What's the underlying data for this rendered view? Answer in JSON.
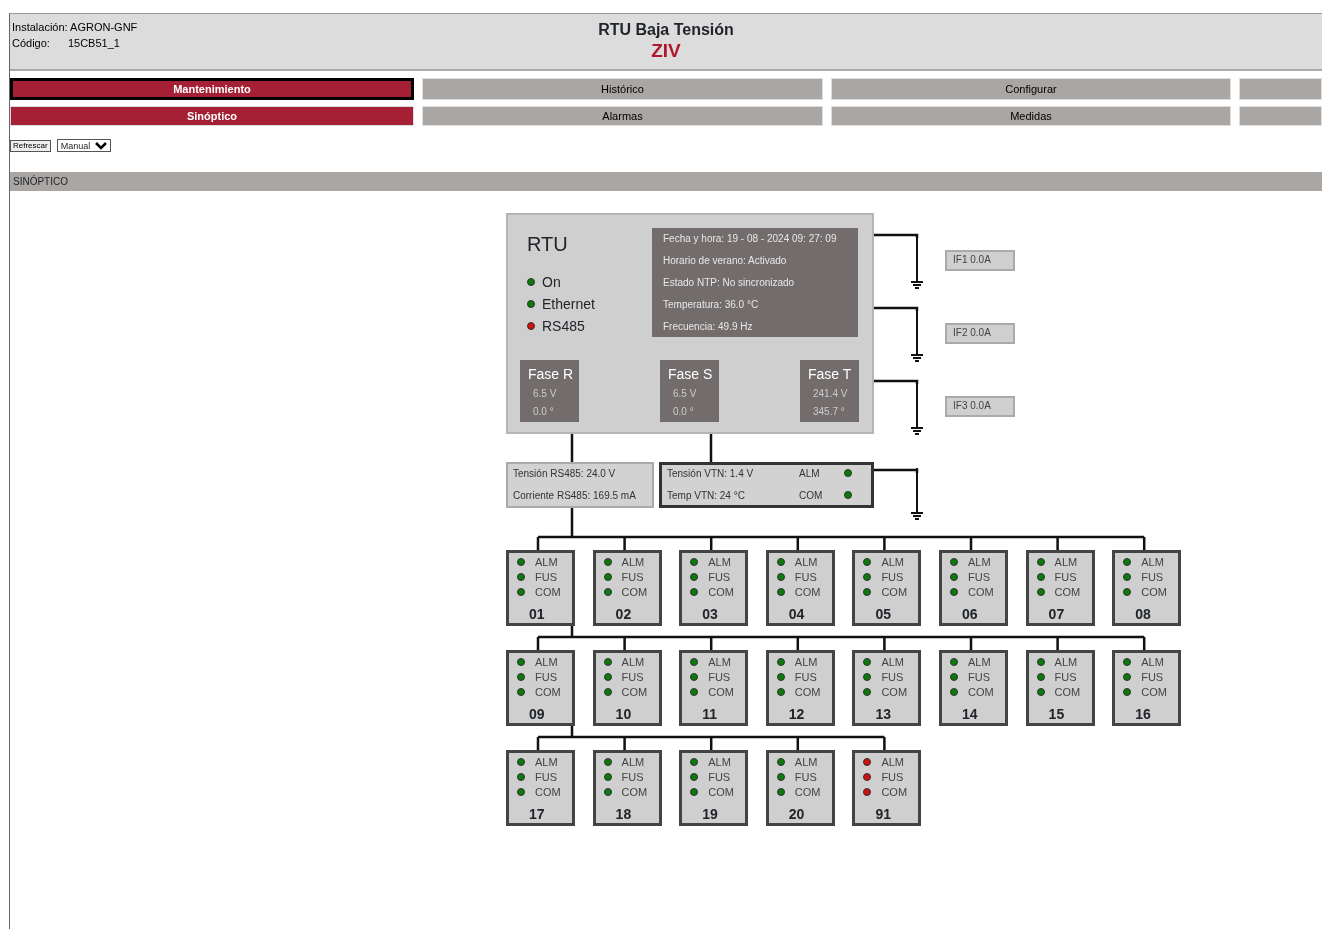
{
  "header": {
    "installation_label": "Instalación:",
    "installation": "AGRON-GNF",
    "code_label": "Código:",
    "code": "15CB51_1",
    "title": "RTU Baja Tensión",
    "brand": "ZIV"
  },
  "menu_rows": [
    [
      {
        "label": "Mantenimiento",
        "selected": true
      },
      {
        "label": "Histórico",
        "selected": false
      },
      {
        "label": "Configurar",
        "selected": false
      },
      {
        "selected": false
      }
    ],
    [
      {
        "label": "Sinóptico",
        "selected": true
      },
      {
        "label": "Alarmas",
        "selected": false
      },
      {
        "label": "Medidas",
        "selected": false
      },
      {
        "selected": false
      }
    ]
  ],
  "toolbar": {
    "refresh_button": "Refrescar",
    "mode_select": "Manual"
  },
  "section_title": "SINÓPTICO",
  "rtu": {
    "title": "RTU",
    "indicators": [
      {
        "label": "On",
        "color": "#0a7a0a"
      },
      {
        "label": "Ethernet",
        "color": "#0a7a0a"
      },
      {
        "label": "RS485",
        "color": "#d01010"
      }
    ],
    "info": [
      "Fecha y hora:  19 - 08 - 2024 09: 27: 09",
      "Horario de verano:  Activado",
      "Estado NTP:  No sincronizado",
      "Temperatura:  36.0 °C",
      "Frecuencia:  49.9 Hz"
    ],
    "phases": [
      {
        "name": "Fase R",
        "voltage": "6.5 V",
        "angle": "0.0 °"
      },
      {
        "name": "Fase S",
        "voltage": "6.5 V",
        "angle": "0.0 °"
      },
      {
        "name": "Fase T",
        "voltage": "241.4 V",
        "angle": "345.7 °"
      }
    ]
  },
  "if_meters": [
    "IF1 0.0A",
    "IF2 0.0A",
    "IF3 0.0A"
  ],
  "rs485": [
    "Tensión RS485:  24.0 V",
    "Corriente RS485:  169.5 mA"
  ],
  "vtn": [
    {
      "text": "Tensión VTN:  1.4 V",
      "label": "ALM",
      "color": "#0a7a0a"
    },
    {
      "text": "Temp VTN:  24 °C",
      "label": "COM",
      "color": "#0a7a0a"
    }
  ],
  "modules": [
    {
      "number": "01",
      "leds": [
        {
          "label": "ALM",
          "color": "#0a7a0a"
        },
        {
          "label": "FUS",
          "color": "#0a7a0a"
        },
        {
          "label": "COM",
          "color": "#0a7a0a"
        }
      ]
    },
    {
      "number": "02",
      "leds": [
        {
          "label": "ALM",
          "color": "#0a7a0a"
        },
        {
          "label": "FUS",
          "color": "#0a7a0a"
        },
        {
          "label": "COM",
          "color": "#0a7a0a"
        }
      ]
    },
    {
      "number": "03",
      "leds": [
        {
          "label": "ALM",
          "color": "#0a7a0a"
        },
        {
          "label": "FUS",
          "color": "#0a7a0a"
        },
        {
          "label": "COM",
          "color": "#0a7a0a"
        }
      ]
    },
    {
      "number": "04",
      "leds": [
        {
          "label": "ALM",
          "color": "#0a7a0a"
        },
        {
          "label": "FUS",
          "color": "#0a7a0a"
        },
        {
          "label": "COM",
          "color": "#0a7a0a"
        }
      ]
    },
    {
      "number": "05",
      "leds": [
        {
          "label": "ALM",
          "color": "#0a7a0a"
        },
        {
          "label": "FUS",
          "color": "#0a7a0a"
        },
        {
          "label": "COM",
          "color": "#0a7a0a"
        }
      ]
    },
    {
      "number": "06",
      "leds": [
        {
          "label": "ALM",
          "color": "#0a7a0a"
        },
        {
          "label": "FUS",
          "color": "#0a7a0a"
        },
        {
          "label": "COM",
          "color": "#0a7a0a"
        }
      ]
    },
    {
      "number": "07",
      "leds": [
        {
          "label": "ALM",
          "color": "#0a7a0a"
        },
        {
          "label": "FUS",
          "color": "#0a7a0a"
        },
        {
          "label": "COM",
          "color": "#0a7a0a"
        }
      ]
    },
    {
      "number": "08",
      "leds": [
        {
          "label": "ALM",
          "color": "#0a7a0a"
        },
        {
          "label": "FUS",
          "color": "#0a7a0a"
        },
        {
          "label": "COM",
          "color": "#0a7a0a"
        }
      ]
    },
    {
      "number": "09",
      "leds": [
        {
          "label": "ALM",
          "color": "#0a7a0a"
        },
        {
          "label": "FUS",
          "color": "#0a7a0a"
        },
        {
          "label": "COM",
          "color": "#0a7a0a"
        }
      ]
    },
    {
      "number": "10",
      "leds": [
        {
          "label": "ALM",
          "color": "#0a7a0a"
        },
        {
          "label": "FUS",
          "color": "#0a7a0a"
        },
        {
          "label": "COM",
          "color": "#0a7a0a"
        }
      ]
    },
    {
      "number": "11",
      "leds": [
        {
          "label": "ALM",
          "color": "#0a7a0a"
        },
        {
          "label": "FUS",
          "color": "#0a7a0a"
        },
        {
          "label": "COM",
          "color": "#0a7a0a"
        }
      ]
    },
    {
      "number": "12",
      "leds": [
        {
          "label": "ALM",
          "color": "#0a7a0a"
        },
        {
          "label": "FUS",
          "color": "#0a7a0a"
        },
        {
          "label": "COM",
          "color": "#0a7a0a"
        }
      ]
    },
    {
      "number": "13",
      "leds": [
        {
          "label": "ALM",
          "color": "#0a7a0a"
        },
        {
          "label": "FUS",
          "color": "#0a7a0a"
        },
        {
          "label": "COM",
          "color": "#0a7a0a"
        }
      ]
    },
    {
      "number": "14",
      "leds": [
        {
          "label": "ALM",
          "color": "#0a7a0a"
        },
        {
          "label": "FUS",
          "color": "#0a7a0a"
        },
        {
          "label": "COM",
          "color": "#0a7a0a"
        }
      ]
    },
    {
      "number": "15",
      "leds": [
        {
          "label": "ALM",
          "color": "#0a7a0a"
        },
        {
          "label": "FUS",
          "color": "#0a7a0a"
        },
        {
          "label": "COM",
          "color": "#0a7a0a"
        }
      ]
    },
    {
      "number": "16",
      "leds": [
        {
          "label": "ALM",
          "color": "#0a7a0a"
        },
        {
          "label": "FUS",
          "color": "#0a7a0a"
        },
        {
          "label": "COM",
          "color": "#0a7a0a"
        }
      ]
    },
    {
      "number": "17",
      "leds": [
        {
          "label": "ALM",
          "color": "#0a7a0a"
        },
        {
          "label": "FUS",
          "color": "#0a7a0a"
        },
        {
          "label": "COM",
          "color": "#0a7a0a"
        }
      ]
    },
    {
      "number": "18",
      "leds": [
        {
          "label": "ALM",
          "color": "#0a7a0a"
        },
        {
          "label": "FUS",
          "color": "#0a7a0a"
        },
        {
          "label": "COM",
          "color": "#0a7a0a"
        }
      ]
    },
    {
      "number": "19",
      "leds": [
        {
          "label": "ALM",
          "color": "#0a7a0a"
        },
        {
          "label": "FUS",
          "color": "#0a7a0a"
        },
        {
          "label": "COM",
          "color": "#0a7a0a"
        }
      ]
    },
    {
      "number": "20",
      "leds": [
        {
          "label": "ALM",
          "color": "#0a7a0a"
        },
        {
          "label": "FUS",
          "color": "#0a7a0a"
        },
        {
          "label": "COM",
          "color": "#0a7a0a"
        }
      ]
    },
    {
      "number": "91",
      "leds": [
        {
          "label": "ALM",
          "color": "#d01010"
        },
        {
          "label": "FUS",
          "color": "#d01010"
        },
        {
          "label": "COM",
          "color": "#d01010"
        }
      ]
    }
  ]
}
